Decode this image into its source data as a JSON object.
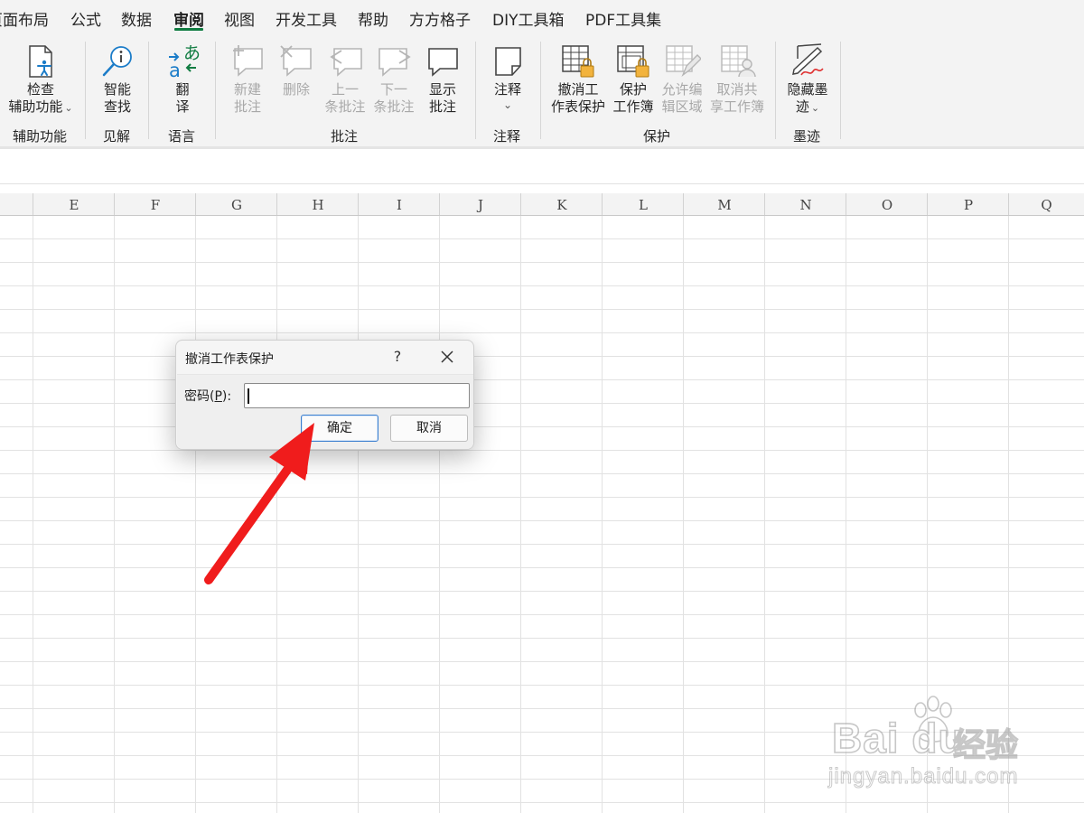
{
  "ribbon_tabs": [
    {
      "label": "页面布局",
      "active": false
    },
    {
      "label": "公式",
      "active": false
    },
    {
      "label": "数据",
      "active": false
    },
    {
      "label": "审阅",
      "active": true
    },
    {
      "label": "视图",
      "active": false
    },
    {
      "label": "开发工具",
      "active": false
    },
    {
      "label": "帮助",
      "active": false
    },
    {
      "label": "方方格子",
      "active": false
    },
    {
      "label": "DIY工具箱",
      "active": false
    },
    {
      "label": "PDF工具集",
      "active": false
    }
  ],
  "ribbon": {
    "groups": {
      "accessibility": "辅助功能",
      "insights": "见解",
      "language": "语言",
      "comments": "批注",
      "notes": "注释",
      "protect": "保护",
      "ink": "墨迹"
    },
    "buttons": {
      "check_accessibility": [
        "检查",
        "辅助功能"
      ],
      "smart_lookup": [
        "智能",
        "查找"
      ],
      "translate": [
        "翻",
        "译"
      ],
      "new_comment": [
        "新建",
        "批注"
      ],
      "delete_comment": [
        "删除"
      ],
      "prev_comment": [
        "上一",
        "条批注"
      ],
      "next_comment": [
        "下一",
        "条批注"
      ],
      "show_comments": [
        "显示",
        "批注"
      ],
      "notes": [
        "注释"
      ],
      "unprotect_sheet": [
        "撤消工",
        "作表保护"
      ],
      "protect_workbook": [
        "保护",
        "工作簿"
      ],
      "allow_edit_ranges": [
        "允许编",
        "辑区域"
      ],
      "unshare_workbook": [
        "取消共",
        "享工作簿"
      ],
      "hide_ink": [
        "隐藏墨",
        "迹"
      ]
    },
    "disabled": [
      "new_comment",
      "delete_comment",
      "prev_comment",
      "next_comment",
      "allow_edit_ranges",
      "unshare_workbook"
    ],
    "translate_glyphs": {
      "top": "あ",
      "bottom": "a"
    }
  },
  "columns": [
    "E",
    "F",
    "G",
    "H",
    "I",
    "J",
    "K",
    "L",
    "M",
    "N",
    "O",
    "P",
    "Q"
  ],
  "dialog": {
    "title": "撤消工作表保护",
    "help": "?",
    "label_prefix": "密码(",
    "label_key": "P",
    "label_suffix": "):",
    "password_value": "",
    "ok": "确定",
    "cancel": "取消"
  },
  "watermark": {
    "main": "Bai du",
    "cn": "经验",
    "sub": "jingyan.baidu.com"
  },
  "colors": {
    "accent": "#107c41",
    "ribbon_bg": "#f3f3f3",
    "arrow": "#f01c1c",
    "ok_border": "#3b7fd0",
    "disabled_text": "#a8a8a8"
  },
  "annotation": {
    "arrow_points_to": "ok-button"
  }
}
